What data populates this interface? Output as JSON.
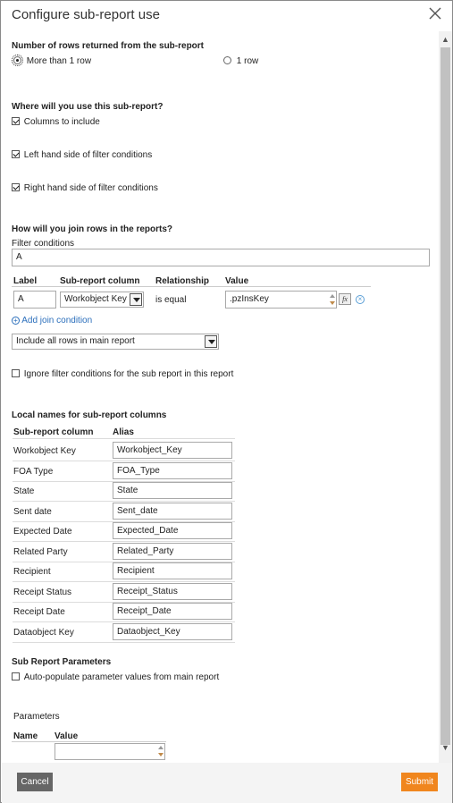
{
  "dialog": {
    "title": "Configure sub-report use"
  },
  "rows_section": {
    "heading": "Number of rows returned from the sub-report",
    "option_many": "More than 1 row",
    "option_one": "1 row"
  },
  "use_section": {
    "heading": "Where will you use this sub-report?",
    "columns": "Columns to include",
    "left": "Left hand side of filter conditions",
    "right": "Right hand side of filter conditions"
  },
  "join_section": {
    "heading": "How will you join rows in the reports?",
    "filter_label": "Filter conditions",
    "filter_value": "A",
    "col_label": "Label",
    "col_subcol": "Sub-report column",
    "col_relationship": "Relationship",
    "col_value": "Value",
    "row_label": "A",
    "row_subcol": "Workobject Key",
    "row_relationship": "is equal",
    "row_value": ".pzInsKey",
    "add_join": "Add join condition",
    "include_select": "Include all rows in main report",
    "ignore_filter": "Ignore filter conditions for the sub report in this report"
  },
  "local_names": {
    "heading": "Local names for sub-report columns",
    "col_subcol": "Sub-report column",
    "col_alias": "Alias",
    "rows": [
      {
        "column": "Workobject Key",
        "alias": "Workobject_Key"
      },
      {
        "column": "FOA Type",
        "alias": "FOA_Type"
      },
      {
        "column": "State",
        "alias": "State"
      },
      {
        "column": "Sent date",
        "alias": "Sent_date"
      },
      {
        "column": "Expected Date",
        "alias": "Expected_Date"
      },
      {
        "column": "Related Party",
        "alias": "Related_Party"
      },
      {
        "column": "Recipient",
        "alias": "Recipient"
      },
      {
        "column": "Receipt Status",
        "alias": "Receipt_Status"
      },
      {
        "column": "Receipt Date",
        "alias": "Receipt_Date"
      },
      {
        "column": "Dataobject Key",
        "alias": "Dataobject_Key"
      }
    ]
  },
  "sub_params": {
    "heading": "Sub Report Parameters",
    "auto_populate": "Auto-populate parameter values from main report",
    "params_label": "Parameters",
    "col_name": "Name",
    "col_value": "Value"
  },
  "footer": {
    "cancel": "Cancel",
    "submit": "Submit"
  },
  "colors": {
    "submit": "#f0861e",
    "cancel": "#666666",
    "link": "#2a6ebb"
  }
}
